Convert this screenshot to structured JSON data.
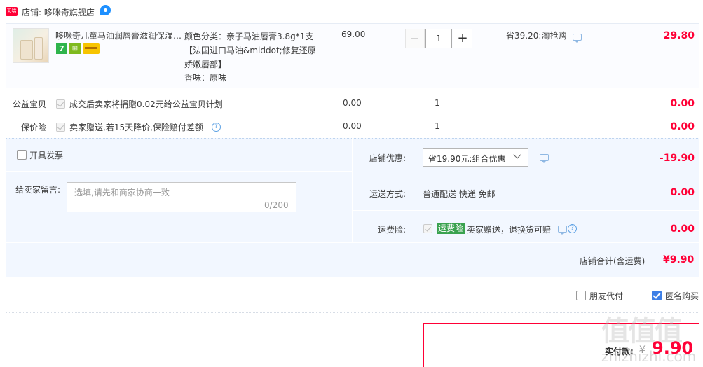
{
  "shop": {
    "badge": "天猫",
    "label": "店铺: 哆咪奇旗舰店"
  },
  "item": {
    "title": "哆咪奇儿童马油润唇膏滋润保湿…",
    "badge_seven": "7",
    "badge_bag": "⊞",
    "sku_line": "颜色分类：亲子马油唇膏3.8g*1支【法国进口马油&middot;修复还原娇嫩唇部】",
    "flavor": "香味：原味",
    "price": "69.00",
    "quantity": "1",
    "qty_minus": "−",
    "qty_plus": "+",
    "saving": "省39.20:淘抢购",
    "total": "29.80"
  },
  "services": [
    {
      "label": "公益宝贝",
      "text": "成交后卖家将捐赠0.02元给公益宝贝计划",
      "price": "0.00",
      "qty": "1",
      "total": "0.00"
    },
    {
      "label": "保价险",
      "text": "卖家赠送,若15天降价,保险赔付差额",
      "price": "0.00",
      "qty": "1",
      "total": "0.00",
      "help": "?"
    }
  ],
  "invoice": {
    "label": "开具发票"
  },
  "memo": {
    "label": "给卖家留言:",
    "placeholder": "选填,请先和商家协商一致",
    "count": "0/200"
  },
  "discount": {
    "label": "店铺优惠:",
    "selected": "省19.90元:组合优惠",
    "value": "-19.90"
  },
  "shipping": {
    "label": "运送方式:",
    "method": "普通配送 快递 免邮",
    "value": "0.00"
  },
  "freight_insurance": {
    "label": "运费险:",
    "tag": "运费险",
    "text": "卖家赠送，退换货可赔",
    "help": "?",
    "value": "0.00"
  },
  "shop_total": {
    "label": "店铺合计(含运费)",
    "value": "¥9.90"
  },
  "options": {
    "friend_pay": "朋友代付",
    "anonymous": "匿名购买"
  },
  "payment": {
    "label": "实付款:",
    "currency": "¥",
    "value": "9.90"
  },
  "watermark": {
    "cn": "值值值",
    "en": "zhizhizhi.com"
  },
  "colors": {
    "accent_red": "#ff0036",
    "block_bg": "#f2f7ff",
    "check_blue": "#3d7fe6",
    "tag_green": "#3aa24f"
  }
}
